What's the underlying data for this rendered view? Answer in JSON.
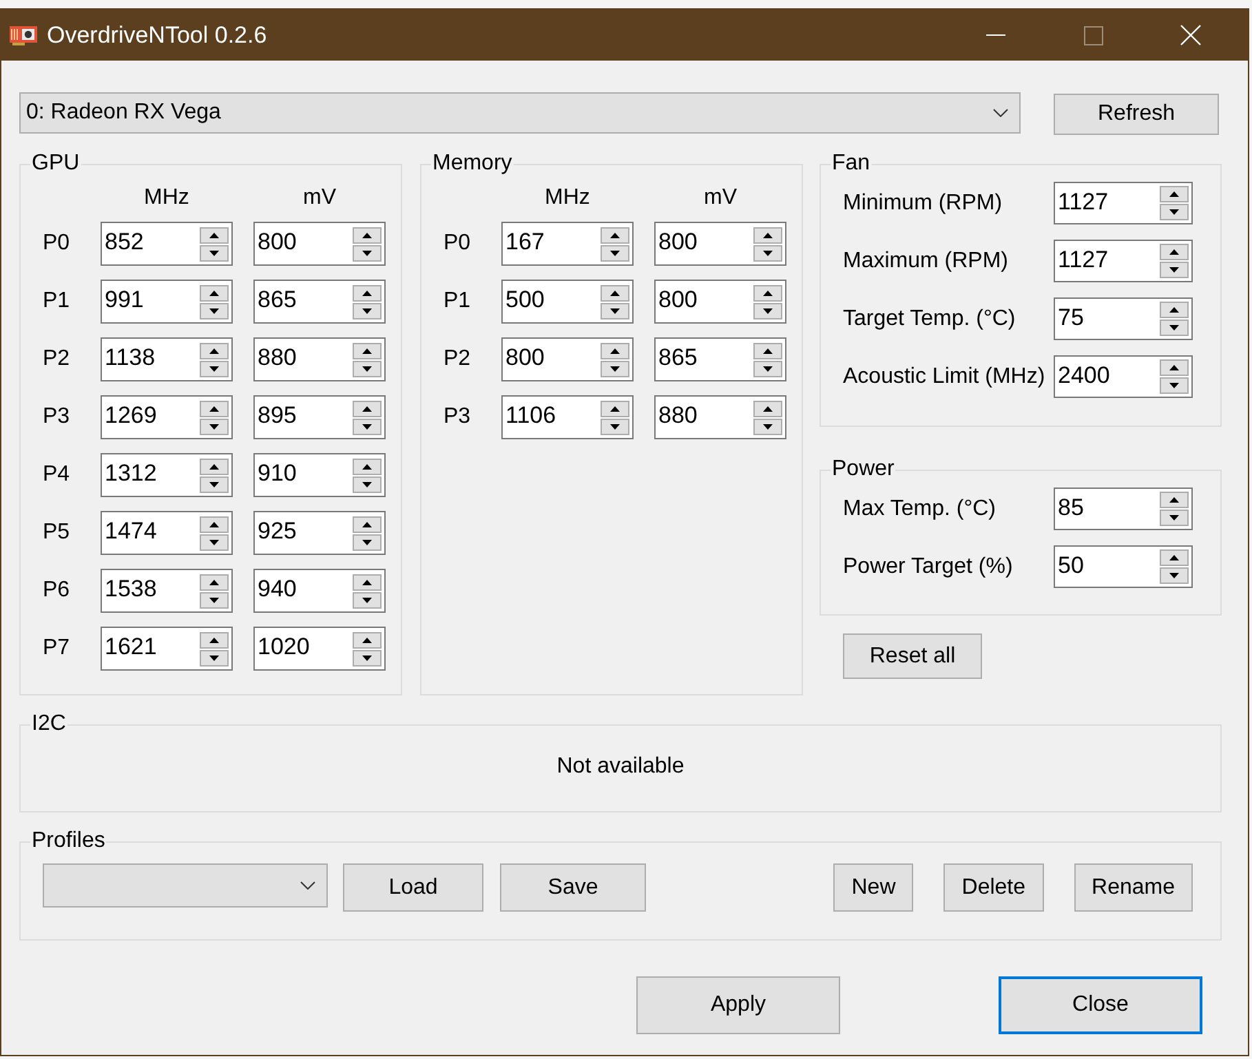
{
  "window": {
    "title": "OverdriveNTool 0.2.6",
    "maximize_disabled": true
  },
  "device_select": {
    "value": "0: Radeon RX Vega"
  },
  "refresh_button": "Refresh",
  "gpu": {
    "title": "GPU",
    "columns": [
      "MHz",
      "mV"
    ],
    "rows": [
      {
        "label": "P0",
        "mhz": "852",
        "mv": "800"
      },
      {
        "label": "P1",
        "mhz": "991",
        "mv": "865"
      },
      {
        "label": "P2",
        "mhz": "1138",
        "mv": "880"
      },
      {
        "label": "P3",
        "mhz": "1269",
        "mv": "895"
      },
      {
        "label": "P4",
        "mhz": "1312",
        "mv": "910"
      },
      {
        "label": "P5",
        "mhz": "1474",
        "mv": "925"
      },
      {
        "label": "P6",
        "mhz": "1538",
        "mv": "940"
      },
      {
        "label": "P7",
        "mhz": "1621",
        "mv": "1020"
      }
    ]
  },
  "memory": {
    "title": "Memory",
    "columns": [
      "MHz",
      "mV"
    ],
    "rows": [
      {
        "label": "P0",
        "mhz": "167",
        "mv": "800"
      },
      {
        "label": "P1",
        "mhz": "500",
        "mv": "800"
      },
      {
        "label": "P2",
        "mhz": "800",
        "mv": "865"
      },
      {
        "label": "P3",
        "mhz": "1106",
        "mv": "880"
      }
    ]
  },
  "fan": {
    "title": "Fan",
    "fields": [
      {
        "label": "Minimum (RPM)",
        "value": "1127"
      },
      {
        "label": "Maximum (RPM)",
        "value": "1127"
      },
      {
        "label": "Target Temp. (°C)",
        "value": "75"
      },
      {
        "label": "Acoustic Limit (MHz)",
        "value": "2400"
      }
    ]
  },
  "power": {
    "title": "Power",
    "fields": [
      {
        "label": "Max Temp. (°C)",
        "value": "85"
      },
      {
        "label": "Power Target (%)",
        "value": "50"
      }
    ]
  },
  "reset_all_button": "Reset all",
  "i2c": {
    "title": "I2C",
    "message": "Not available"
  },
  "profiles": {
    "title": "Profiles",
    "file_buttons": [
      "Load",
      "Save"
    ],
    "manage_buttons": [
      "New",
      "Delete",
      "Rename"
    ]
  },
  "dialog_buttons": [
    {
      "label": "Apply",
      "default": false
    },
    {
      "label": "Close",
      "default": true
    }
  ]
}
